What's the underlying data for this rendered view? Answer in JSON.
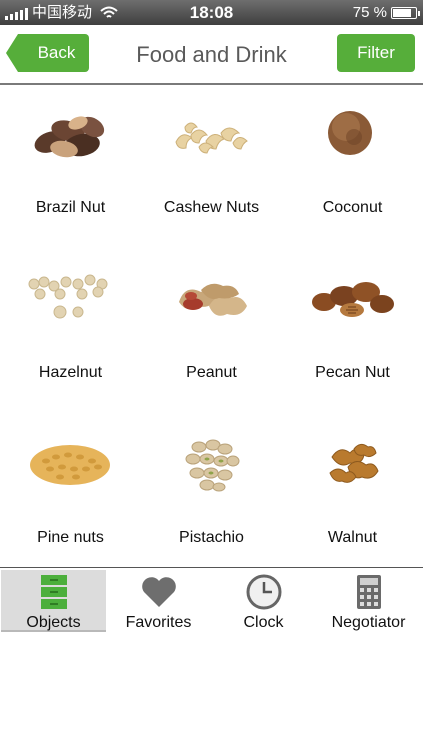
{
  "status_bar": {
    "carrier": "中国移动",
    "time": "18:08",
    "battery_text": "75 %",
    "battery_level": 0.75,
    "icons": [
      "signal-bars-icon",
      "wifi-icon",
      "battery-icon"
    ]
  },
  "nav": {
    "back_label": "Back",
    "title": "Food and Drink",
    "filter_label": "Filter"
  },
  "items": [
    {
      "label": "Brazil Nut",
      "icon": "brazil-nut-image"
    },
    {
      "label": "Cashew Nuts",
      "icon": "cashew-nuts-image"
    },
    {
      "label": "Coconut",
      "icon": "coconut-image"
    },
    {
      "label": "Hazelnut",
      "icon": "hazelnut-image"
    },
    {
      "label": "Peanut",
      "icon": "peanut-image"
    },
    {
      "label": "Pecan Nut",
      "icon": "pecan-nut-image"
    },
    {
      "label": "Pine nuts",
      "icon": "pine-nuts-image"
    },
    {
      "label": "Pistachio",
      "icon": "pistachio-image"
    },
    {
      "label": "Walnut",
      "icon": "walnut-image"
    }
  ],
  "tabs": [
    {
      "label": "Objects",
      "icon": "drawers-icon",
      "active": true
    },
    {
      "label": "Favorites",
      "icon": "heart-icon",
      "active": false
    },
    {
      "label": "Clock",
      "icon": "clock-icon",
      "active": false
    },
    {
      "label": "Negotiator",
      "icon": "calculator-icon",
      "active": false
    }
  ],
  "colors": {
    "accent": "#56ae3a",
    "title_text": "#5a5a5a",
    "tab_active_bg": "#dcdcdc"
  }
}
